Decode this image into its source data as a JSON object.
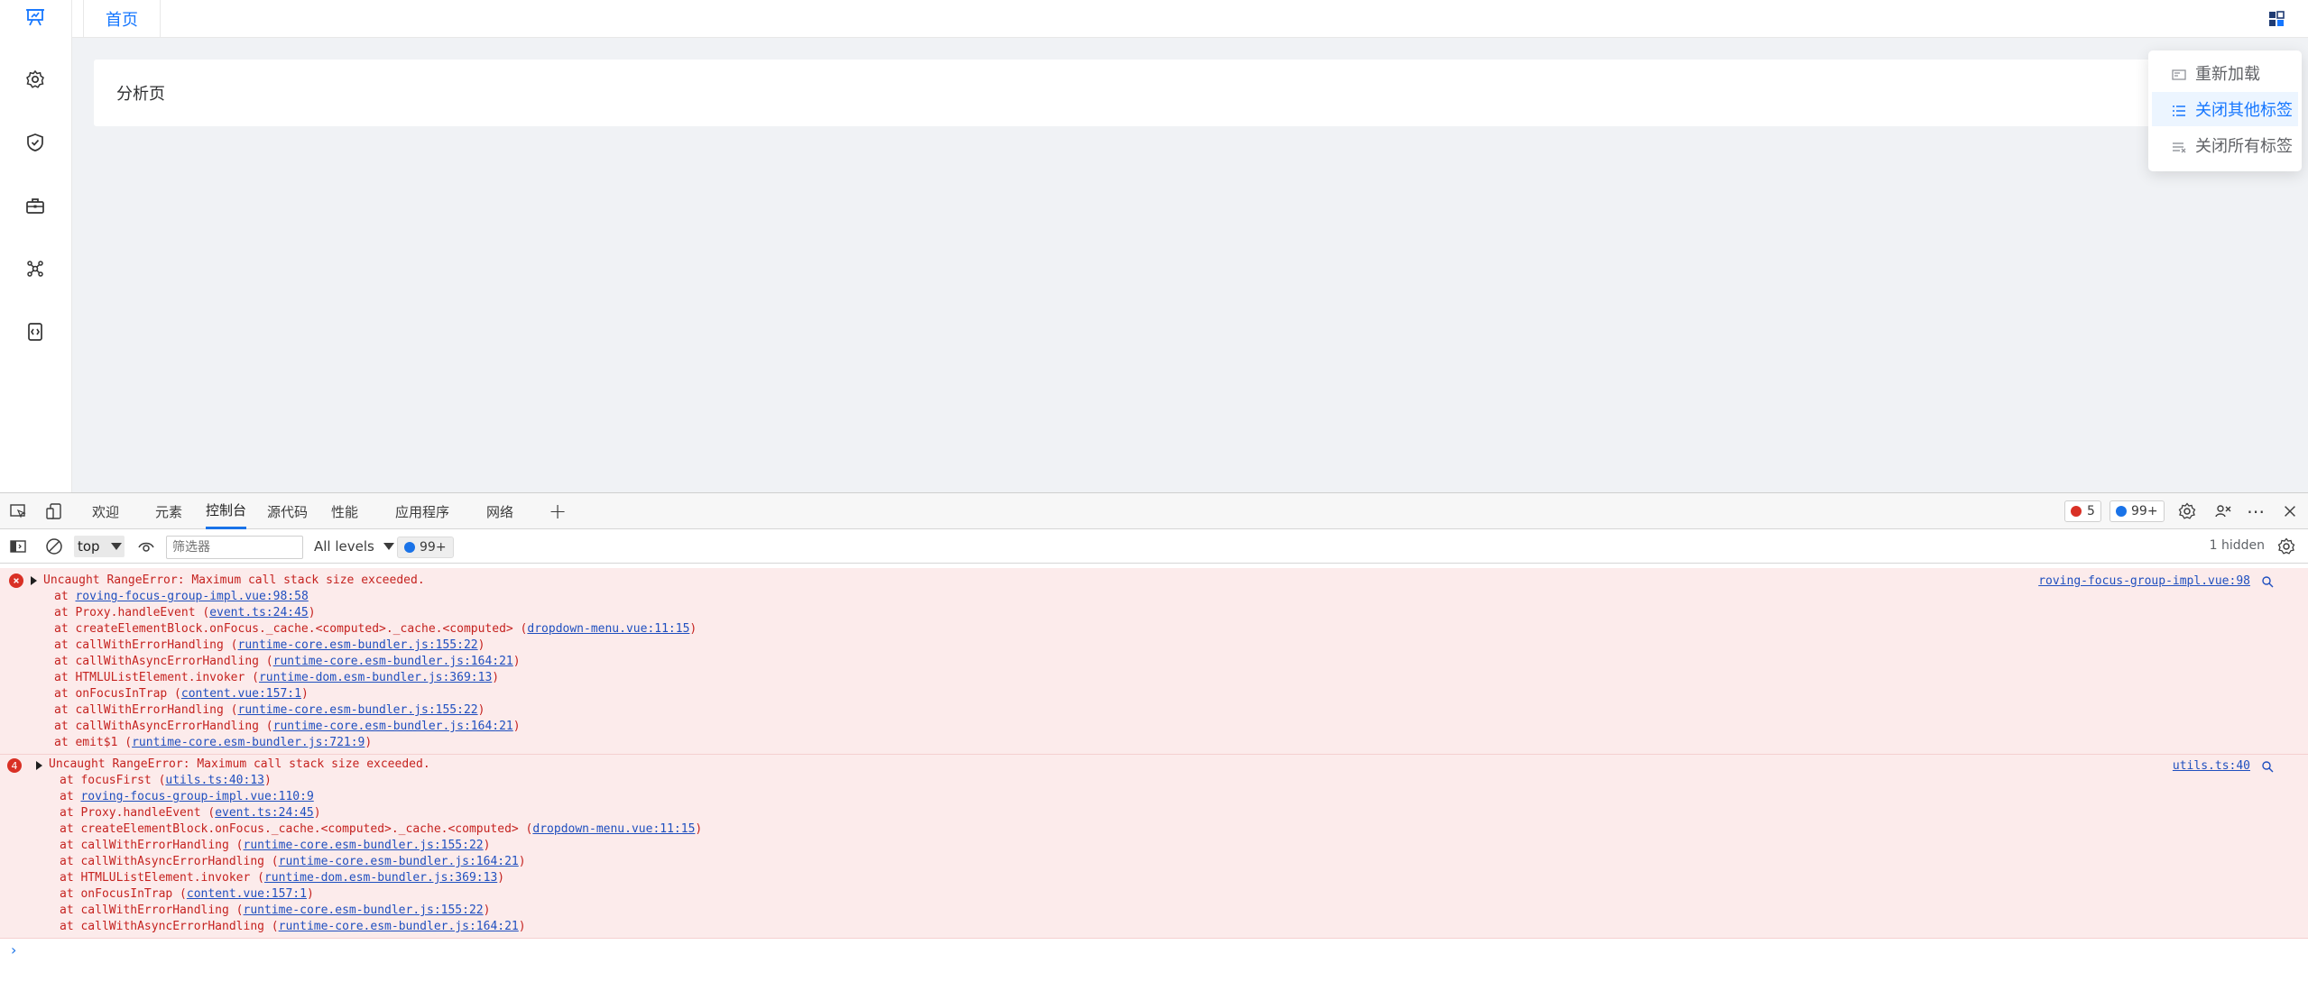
{
  "app": {
    "tab_home": "首页",
    "card_title": "分析页",
    "sidebar_icons": [
      "presentation-icon",
      "gear-icon",
      "shield-check-icon",
      "toolbox-icon",
      "network-icon",
      "bracket-icon"
    ],
    "tabbar_menu_icon": "grid-menu-icon",
    "dropdown": {
      "items": [
        {
          "label": "重新加载",
          "icon": "reload-tab-icon",
          "active": false
        },
        {
          "label": "关闭其他标签",
          "icon": "close-others-icon",
          "active": true
        },
        {
          "label": "关闭所有标签",
          "icon": "close-all-icon",
          "active": false
        }
      ]
    },
    "accent_color": "#1677ff"
  },
  "devtools": {
    "tabs": [
      {
        "label": "欢迎",
        "active": false
      },
      {
        "label": "元素",
        "active": false
      },
      {
        "label": "控制台",
        "active": true
      },
      {
        "label": "源代码",
        "active": false
      },
      {
        "label": "性能",
        "active": false
      },
      {
        "label": "应用程序",
        "active": false
      },
      {
        "label": "网络",
        "active": false
      }
    ],
    "add_tab": "+",
    "error_count": "5",
    "message_count": "99+",
    "toolbar": {
      "context": "top",
      "filter_placeholder": "筛选器",
      "levels": "All levels",
      "message_count": "99+",
      "hidden": "1 hidden"
    },
    "errors": [
      {
        "header": "Uncaught RangeError: Maximum call stack size exceeded.",
        "source": "roving-focus-group-impl.vue:98",
        "badge": "",
        "frames": [
          {
            "fn": "at ",
            "link": "roving-focus-group-impl.vue:98:58",
            "pre": "",
            "post": ""
          },
          {
            "fn": "at Proxy.handleEvent (",
            "link": "event.ts:24:45",
            "post": ")"
          },
          {
            "fn": "at createElementBlock.onFocus._cache.<computed>._cache.<computed> (",
            "link": "dropdown-menu.vue:11:15",
            "post": ")"
          },
          {
            "fn": "at callWithErrorHandling (",
            "link": "runtime-core.esm-bundler.js:155:22",
            "post": ")"
          },
          {
            "fn": "at callWithAsyncErrorHandling (",
            "link": "runtime-core.esm-bundler.js:164:21",
            "post": ")"
          },
          {
            "fn": "at HTMLUListElement.invoker (",
            "link": "runtime-dom.esm-bundler.js:369:13",
            "post": ")"
          },
          {
            "fn": "at onFocusInTrap (",
            "link": "content.vue:157:1",
            "post": ")"
          },
          {
            "fn": "at callWithErrorHandling (",
            "link": "runtime-core.esm-bundler.js:155:22",
            "post": ")"
          },
          {
            "fn": "at callWithAsyncErrorHandling (",
            "link": "runtime-core.esm-bundler.js:164:21",
            "post": ")"
          },
          {
            "fn": "at emit$1 (",
            "link": "runtime-core.esm-bundler.js:721:9",
            "post": ")"
          }
        ]
      },
      {
        "header": "Uncaught RangeError: Maximum call stack size exceeded.",
        "source": "utils.ts:40",
        "badge": "4",
        "frames": [
          {
            "fn": "at focusFirst (",
            "link": "utils.ts:40:13",
            "post": ")"
          },
          {
            "fn": "at ",
            "link": "roving-focus-group-impl.vue:110:9",
            "post": ""
          },
          {
            "fn": "at Proxy.handleEvent (",
            "link": "event.ts:24:45",
            "post": ")"
          },
          {
            "fn": "at createElementBlock.onFocus._cache.<computed>._cache.<computed> (",
            "link": "dropdown-menu.vue:11:15",
            "post": ")"
          },
          {
            "fn": "at callWithErrorHandling (",
            "link": "runtime-core.esm-bundler.js:155:22",
            "post": ")"
          },
          {
            "fn": "at callWithAsyncErrorHandling (",
            "link": "runtime-core.esm-bundler.js:164:21",
            "post": ")"
          },
          {
            "fn": "at HTMLUListElement.invoker (",
            "link": "runtime-dom.esm-bundler.js:369:13",
            "post": ")"
          },
          {
            "fn": "at onFocusInTrap (",
            "link": "content.vue:157:1",
            "post": ")"
          },
          {
            "fn": "at callWithErrorHandling (",
            "link": "runtime-core.esm-bundler.js:155:22",
            "post": ")"
          },
          {
            "fn": "at callWithAsyncErrorHandling (",
            "link": "runtime-core.esm-bundler.js:164:21",
            "post": ")"
          }
        ]
      }
    ],
    "prompt": "›"
  }
}
